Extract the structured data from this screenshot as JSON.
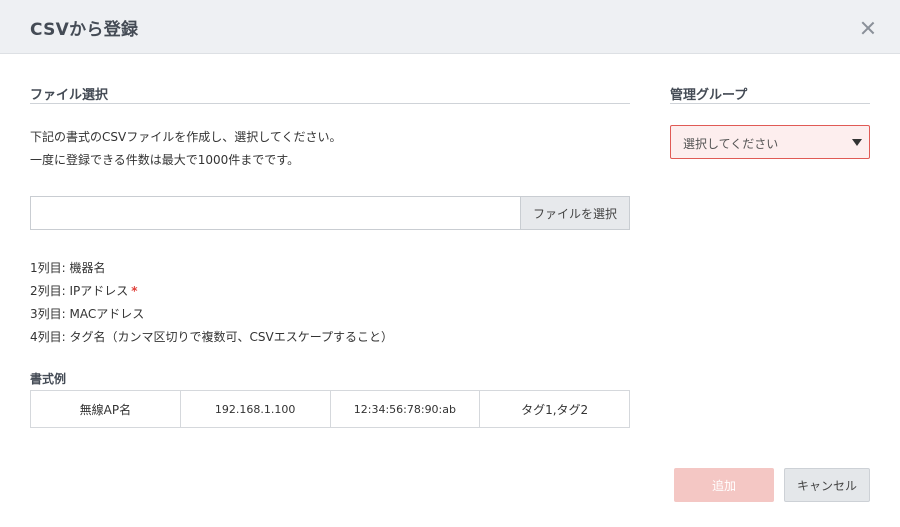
{
  "dialog": {
    "title": "CSVから登録",
    "close_icon": "close-icon"
  },
  "file_section": {
    "title": "ファイル選択",
    "description_lines": [
      "下記の書式のCSVファイルを作成し、選択してください。",
      "一度に登録できる件数は最大で1000件までです。"
    ],
    "file_input": {
      "value": "",
      "placeholder": ""
    },
    "choose_button_label": "ファイルを選択",
    "columns": [
      {
        "text": "1列目: 機器名",
        "required": false
      },
      {
        "text": "2列目: IPアドレス",
        "required": true,
        "required_mark": "*"
      },
      {
        "text": "3列目: MACアドレス",
        "required": false
      },
      {
        "text": "4列目: タグ名（カンマ区切りで複数可、CSVエスケープすること）",
        "required": false
      }
    ],
    "example_title": "書式例",
    "example_row": [
      "無線AP名",
      "192.168.1.100",
      "12:34:56:78:90:ab",
      "タグ1,タグ2"
    ]
  },
  "group_section": {
    "title": "管理グループ",
    "select": {
      "selected": "選択してください",
      "icon": "triangle-down-icon"
    }
  },
  "footer": {
    "add_label": "追加",
    "cancel_label": "キャンセル"
  },
  "colors": {
    "header_bg": "#eef0f3",
    "error_border": "#e05a55",
    "error_bg": "#fdeeee",
    "add_button_disabled": "#f4c7c4",
    "required_mark": "#e0403a"
  }
}
